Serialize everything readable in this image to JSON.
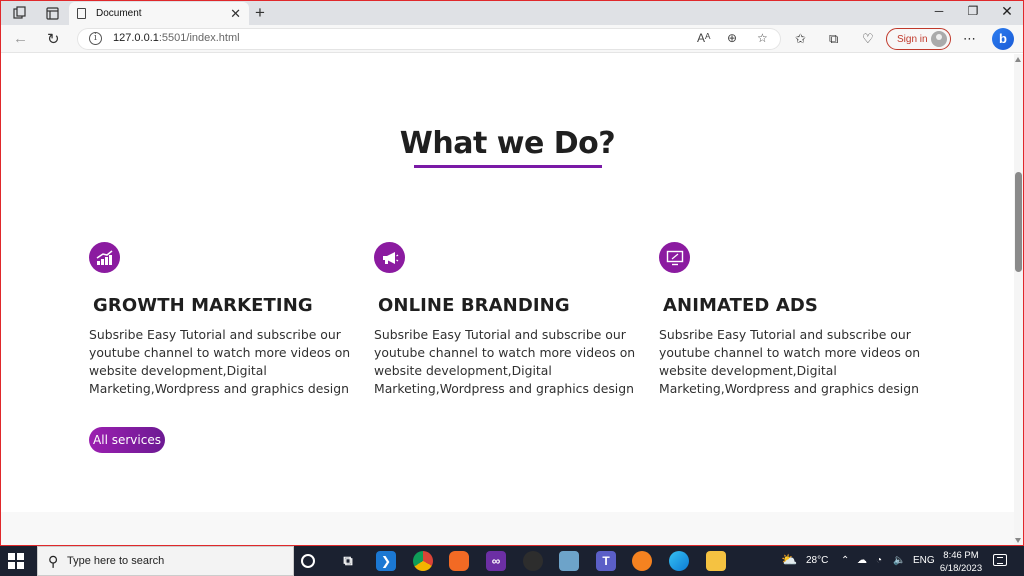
{
  "browser": {
    "tab_title": "Document",
    "url_host": "127.0.0.1",
    "url_path": ":5501/index.html",
    "sign_in_label": "Sign in",
    "bing_label": "b"
  },
  "page": {
    "heading": "What we Do?",
    "services": [
      {
        "icon": "growth-chart-icon",
        "title": "GROWTH MARKETING",
        "text": "Subsribe Easy Tutorial and subscribe our youtube channel to watch more videos on website development,Digital Marketing,Wordpress and graphics design"
      },
      {
        "icon": "megaphone-icon",
        "title": "ONLINE BRANDING",
        "text": "Subsribe Easy Tutorial and subscribe our youtube channel to watch more videos on website development,Digital Marketing,Wordpress and graphics design"
      },
      {
        "icon": "monitor-icon",
        "title": "ANIMATED ADS",
        "text": "Subsribe Easy Tutorial and subscribe our youtube channel to watch more videos on website development,Digital Marketing,Wordpress and graphics design"
      }
    ],
    "all_services_label": "All services",
    "accent_color": "#8b1ba0"
  },
  "taskbar": {
    "search_placeholder": "Type here to search",
    "temperature": "28°C",
    "language": "ENG",
    "time": "8:46 PM",
    "date": "6/18/2023"
  }
}
